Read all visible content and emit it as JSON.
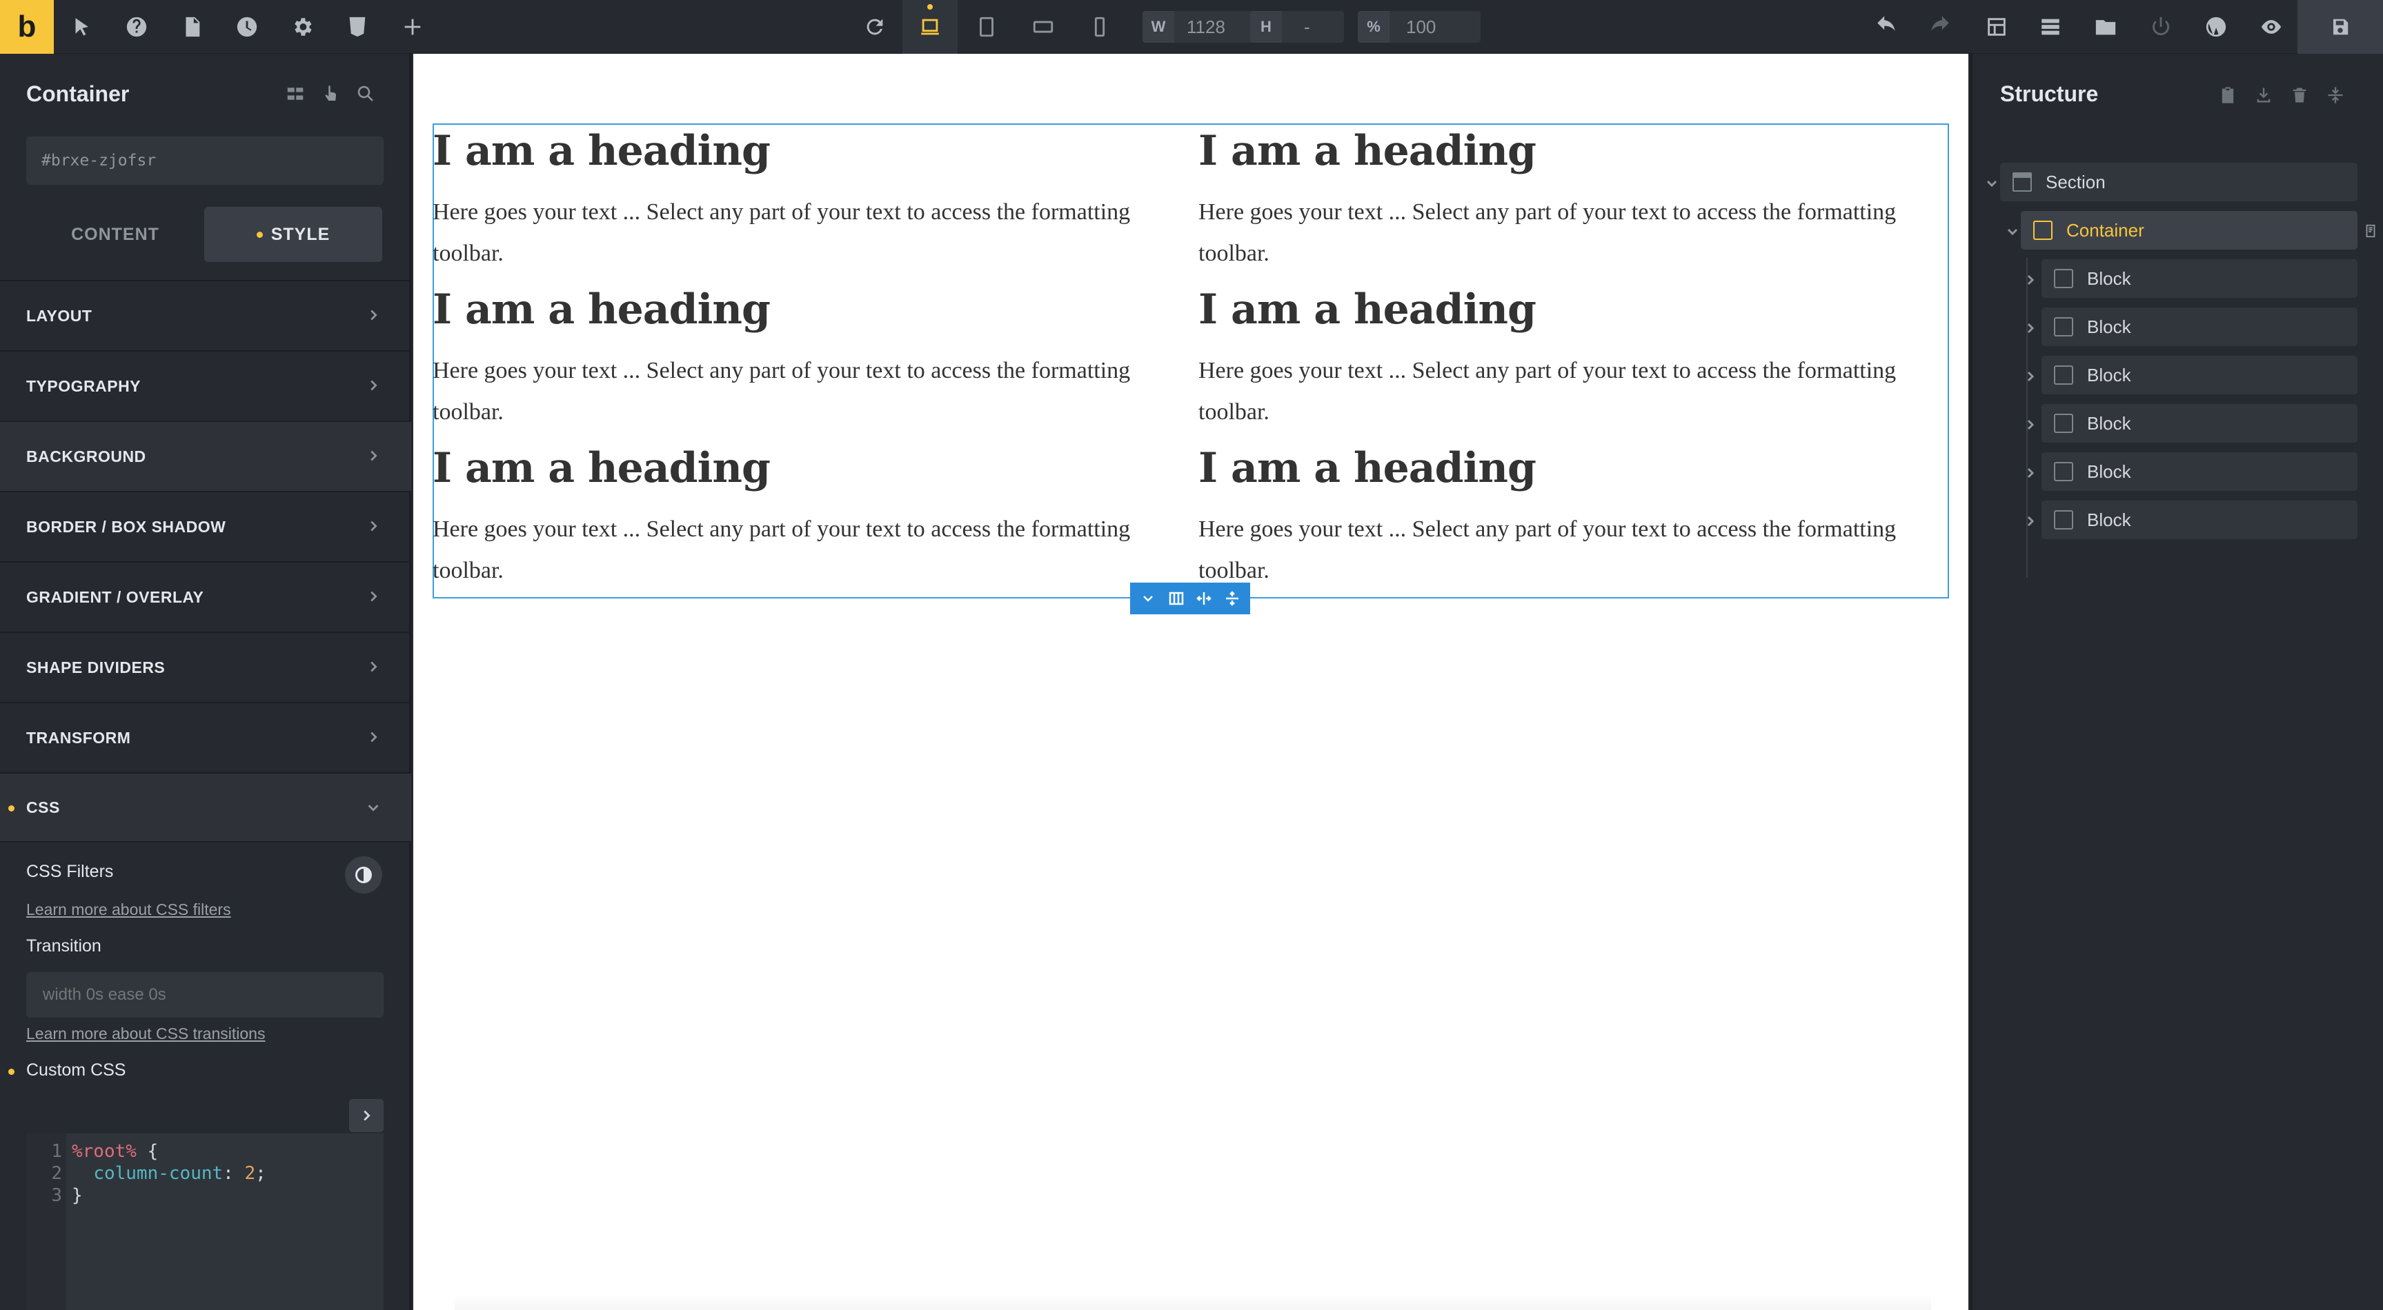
{
  "app": {
    "logo": "b"
  },
  "toolbar": {
    "width_label": "W",
    "width_value": "1128",
    "height_label": "H",
    "height_value": "-",
    "zoom_label": "%",
    "zoom_value": "100"
  },
  "left_panel": {
    "title": "Container",
    "element_id": "#brxe-zjofsr",
    "tabs": [
      {
        "label": "CONTENT"
      },
      {
        "label": "STYLE"
      }
    ],
    "sections": [
      {
        "label": "LAYOUT"
      },
      {
        "label": "TYPOGRAPHY"
      },
      {
        "label": "BACKGROUND"
      },
      {
        "label": "BORDER / BOX SHADOW"
      },
      {
        "label": "GRADIENT / OVERLAY"
      },
      {
        "label": "SHAPE DIVIDERS"
      },
      {
        "label": "TRANSFORM"
      },
      {
        "label": "CSS"
      }
    ],
    "css": {
      "filters_label": "CSS Filters",
      "filters_link": "Learn more about CSS filters",
      "transition_label": "Transition",
      "transition_placeholder": "width 0s ease 0s",
      "transition_link": "Learn more about CSS transitions",
      "custom_css_label": "Custom CSS",
      "code": {
        "line_numbers": [
          "1",
          "2",
          "3"
        ],
        "selector": "%root%",
        "open_brace": " {",
        "property": "column-count",
        "colon": ": ",
        "value": "2",
        "semicolon": ";",
        "close_brace": "}"
      }
    }
  },
  "canvas": {
    "blocks": [
      {
        "heading": "I am a heading",
        "text": "Here goes your text ... Select any part of your text to access the formatting toolbar."
      },
      {
        "heading": "I am a heading",
        "text": "Here goes your text ... Select any part of your text to access the formatting toolbar."
      },
      {
        "heading": "I am a heading",
        "text": "Here goes your text ... Select any part of your text to access the formatting toolbar."
      },
      {
        "heading": "I am a heading",
        "text": "Here goes your text ... Select any part of your text to access the formatting toolbar."
      },
      {
        "heading": "I am a heading",
        "text": "Here goes your text ... Select any part of your text to access the formatting toolbar."
      },
      {
        "heading": "I am a heading",
        "text": "Here goes your text ... Select any part of your text to access the formatting toolbar."
      }
    ]
  },
  "structure": {
    "title": "Structure",
    "section": "Section",
    "container": "Container",
    "blocks": [
      "Block",
      "Block",
      "Block",
      "Block",
      "Block",
      "Block"
    ]
  },
  "colors": {
    "accent": "#f8c63b",
    "selection": "#3a9fe0"
  }
}
